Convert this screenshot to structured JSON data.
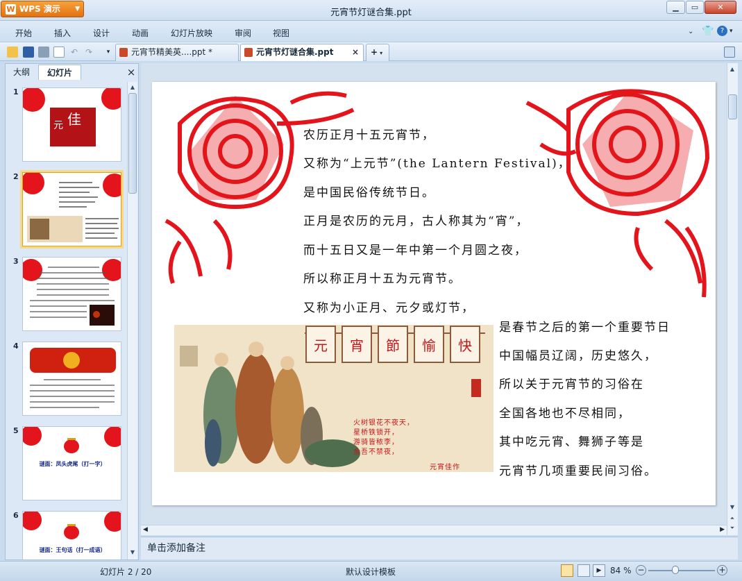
{
  "app": {
    "name": "WPS 演示",
    "title": "元宵节灯谜合集.ppt"
  },
  "menu": [
    "开始",
    "插入",
    "设计",
    "动画",
    "幻灯片放映",
    "审阅",
    "视图"
  ],
  "tabs": [
    {
      "label": "元宵节精美英....ppt *",
      "active": false
    },
    {
      "label": "元宵节灯谜合集.ppt",
      "active": true
    }
  ],
  "panel": {
    "tabs": [
      "大纲",
      "幻灯片"
    ],
    "close": "×"
  },
  "thumbnails": [
    {
      "num": "1",
      "caption": ""
    },
    {
      "num": "2",
      "caption": ""
    },
    {
      "num": "3",
      "caption": ""
    },
    {
      "num": "4",
      "caption": ""
    },
    {
      "num": "5",
      "caption": "谜面：凤头虎尾（打一字）"
    },
    {
      "num": "6",
      "caption": "谜面：王句话（打一成语）"
    }
  ],
  "slide": {
    "lines": [
      "农历正月十五元宵节，",
      "又称为“上元节”(the Lantern Festival)，",
      "是中国民俗传统节日。",
      "正月是农历的元月，古人称其为“宵”，",
      "而十五日又是一年中第一个月圆之夜，",
      "所以称正月十五为元宵节。",
      "又称为小正月、元夕或灯节，",
      "是春节之后的第一个重要节日",
      "中国幅员辽阔，历史悠久，",
      "所以关于元宵节的习俗在",
      "全国各地也不尽相同，",
      "其中吃元宵、舞狮子等是",
      "元宵节几项重要民间习俗。"
    ],
    "lanterns": [
      "元",
      "宵",
      "節",
      "愉",
      "快"
    ],
    "poem": [
      "火树银花不夜天，",
      "星桥铁锁开，",
      "游骑皆秾李，",
      "金吾不禁夜，",
      "元宵佳作"
    ]
  },
  "notes": {
    "placeholder": "单击添加备注"
  },
  "status": {
    "slide_info": "幻灯片 2 / 20",
    "template": "默认设计模板",
    "zoom": "84 %"
  },
  "colors": {
    "accent": "#e27212",
    "paper_cut": "#e3141b",
    "selection": "#f5d98a"
  }
}
